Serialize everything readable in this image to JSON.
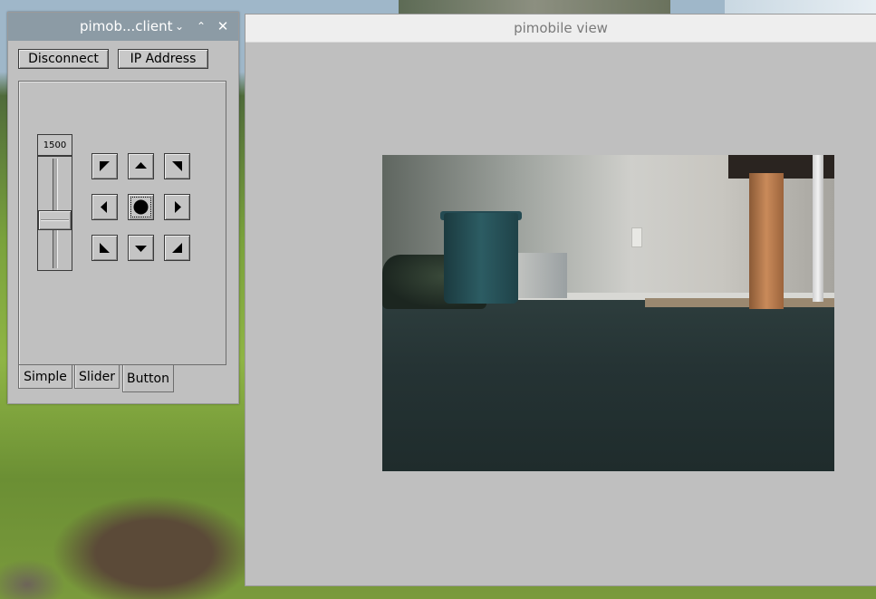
{
  "client_window": {
    "title": "pimob...client",
    "title_buttons": {
      "minimize": "⌄",
      "maximize": "⌃",
      "close": "✕"
    },
    "disconnect_label": "Disconnect",
    "ip_address_label": "IP Address",
    "speed_value": "1500",
    "slider_level_fraction": 0.5,
    "direction_buttons": [
      "up-left-icon",
      "up-icon",
      "up-right-icon",
      "left-icon",
      "stop-icon",
      "right-icon",
      "down-left-icon",
      "down-icon",
      "down-right-icon"
    ],
    "focused_button": "stop-icon",
    "tabs": [
      {
        "label": "Simple",
        "selected": false
      },
      {
        "label": "Slider",
        "selected": false
      },
      {
        "label": "Button",
        "selected": true
      }
    ]
  },
  "view_window": {
    "title": "pimobile view",
    "camera_feed": "live camera image"
  },
  "colors": {
    "client_titlebar": "#8c9ba5",
    "window_bg": "#c0c0c0",
    "view_titlebar": "#eeeeee"
  }
}
